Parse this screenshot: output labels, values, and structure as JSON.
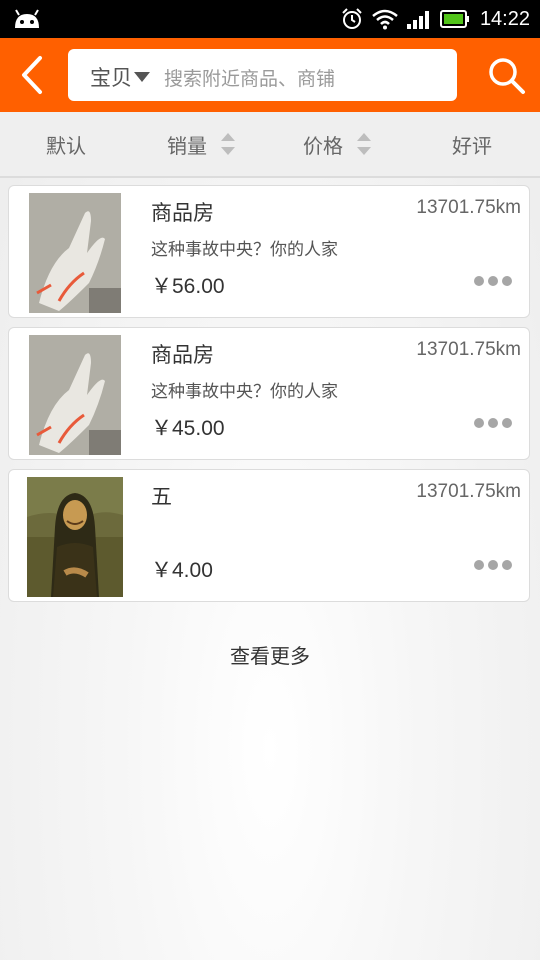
{
  "status_bar": {
    "time": "14:22",
    "icons": [
      "android-icon",
      "alarm-icon",
      "wifi-icon",
      "signal-icon",
      "battery-icon"
    ]
  },
  "header": {
    "back_icon": "chevron-left-icon",
    "search": {
      "scope": "宝贝",
      "placeholder": "搜索附近商品、商铺"
    },
    "search_icon": "search-icon",
    "accent_color": "#ff6000"
  },
  "sort_tabs": [
    {
      "label": "默认"
    },
    {
      "label": "销量",
      "sortable": true
    },
    {
      "label": "价格",
      "sortable": true
    },
    {
      "label": "好评"
    }
  ],
  "items": [
    {
      "title": "商品房",
      "distance": "13701.75km",
      "desc": "这种事故中央？你的人家",
      "price": "￥56.00",
      "image": "gloves-photo"
    },
    {
      "title": "商品房",
      "distance": "13701.75km",
      "desc": "这种事故中央？你的人家",
      "price": "￥45.00",
      "image": "gloves-photo"
    },
    {
      "title": "五",
      "distance": "13701.75km",
      "desc": "",
      "price": "￥4.00",
      "image": "mona-lisa-parody-photo"
    }
  ],
  "load_more": "查看更多"
}
